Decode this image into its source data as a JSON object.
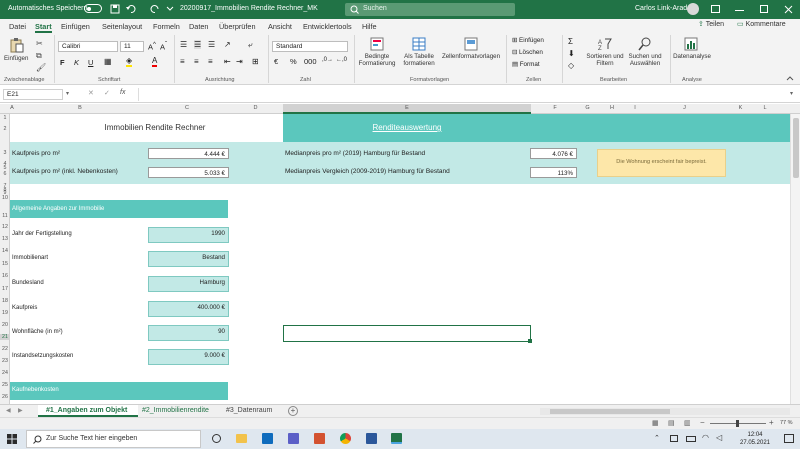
{
  "titlebar": {
    "autosave_label": "Automatisches Speichern",
    "filename": "20200917_Immobilien Rendite Rechner_MK",
    "search_placeholder": "Suchen",
    "user": "Carlos Link-Arad"
  },
  "menu_tabs": [
    "Datei",
    "Start",
    "Einfügen",
    "Seitenlayout",
    "Formeln",
    "Daten",
    "Überprüfen",
    "Ansicht",
    "Entwicklertools",
    "Hilfe"
  ],
  "share_label": "Teilen",
  "comments_label": "Kommentare",
  "ribbon": {
    "paste_label": "Einfügen",
    "font_name": "Calibri",
    "font_size": "11",
    "number_format": "Standard",
    "cond_format": [
      "Bedingte",
      "Formatierung"
    ],
    "as_table": [
      "Als Tabelle",
      "formatieren"
    ],
    "cell_styles": "Zellenformatvorlagen",
    "insert": "Einfügen",
    "delete": "Löschen",
    "format": "Format",
    "sort_filter": [
      "Sortieren und",
      "Filtern"
    ],
    "find_select": [
      "Suchen und",
      "Auswählen"
    ],
    "analyze": "Datenanalyse",
    "groups": {
      "clipboard": "Zwischenablage",
      "font": "Schriftart",
      "alignment": "Ausrichtung",
      "number": "Zahl",
      "styles": "Formatvorlagen",
      "cells": "Zellen",
      "editing": "Bearbeiten",
      "analysis": "Analyse"
    }
  },
  "name_box": "E21",
  "formula_value": "",
  "columns": [
    "A",
    "B",
    "C",
    "D",
    "E",
    "F",
    "G",
    "H",
    "I",
    "J",
    "K",
    "L"
  ],
  "rows": [
    "1",
    "2",
    "3",
    "4",
    "5",
    "6",
    "7",
    "8",
    "9",
    "10",
    "11",
    "12",
    "13",
    "14",
    "15",
    "16",
    "17",
    "18",
    "19",
    "20",
    "21",
    "22",
    "23",
    "24",
    "25",
    "26"
  ],
  "sheet": {
    "title": "Immobilien Rendite Rechner",
    "eval_title": "Renditeauswertung",
    "kaufpreis_qm_label": "Kaufpreis pro m²",
    "kaufpreis_qm_value": "4.444 €",
    "kaufpreis_qm_nk_label": "Kaufpreis pro m² (inkl. Nebenkosten)",
    "kaufpreis_qm_nk_value": "5.033 €",
    "median_label": "Medianpreis pro m² (2019) Hamburg für Bestand",
    "median_value": "4.076 €",
    "vergleich_label": "Medianpreis Vergleich (2009-2019) Hamburg für Bestand",
    "vergleich_value": "113%",
    "note": "Die Wohnung erscheint fair bepreist.",
    "section_general": "Allgemeine Angaben zur Immobilie",
    "baujahr_label": "Jahr der Fertigstellung",
    "baujahr_value": "1990",
    "art_label": "Immobilienart",
    "art_value": "Bestand",
    "land_label": "Bundesland",
    "land_value": "Hamburg",
    "kaufpreis_label": "Kaufpreis",
    "kaufpreis_value": "400.000 €",
    "flaeche_label": "Wohnfläche (in m²)",
    "flaeche_value": "90",
    "instand_label": "Instandsetzungskosten",
    "instand_value": "9.000 €",
    "section_nebenkosten": "Kaufnebenkosten"
  },
  "sheet_tabs": [
    "#1_Angaben zum Objekt",
    "#2_Immobilienrendite",
    "#3_Datenraum"
  ],
  "zoom": "77 %",
  "taskbar": {
    "search_placeholder": "Zur Suche Text hier eingeben",
    "time": "12:04",
    "date": "27.05.2021"
  },
  "colors": {
    "accent": "#217346",
    "teal": "#5bc7bd",
    "light_teal": "#c2e9e6",
    "note": "#fde7a9"
  }
}
